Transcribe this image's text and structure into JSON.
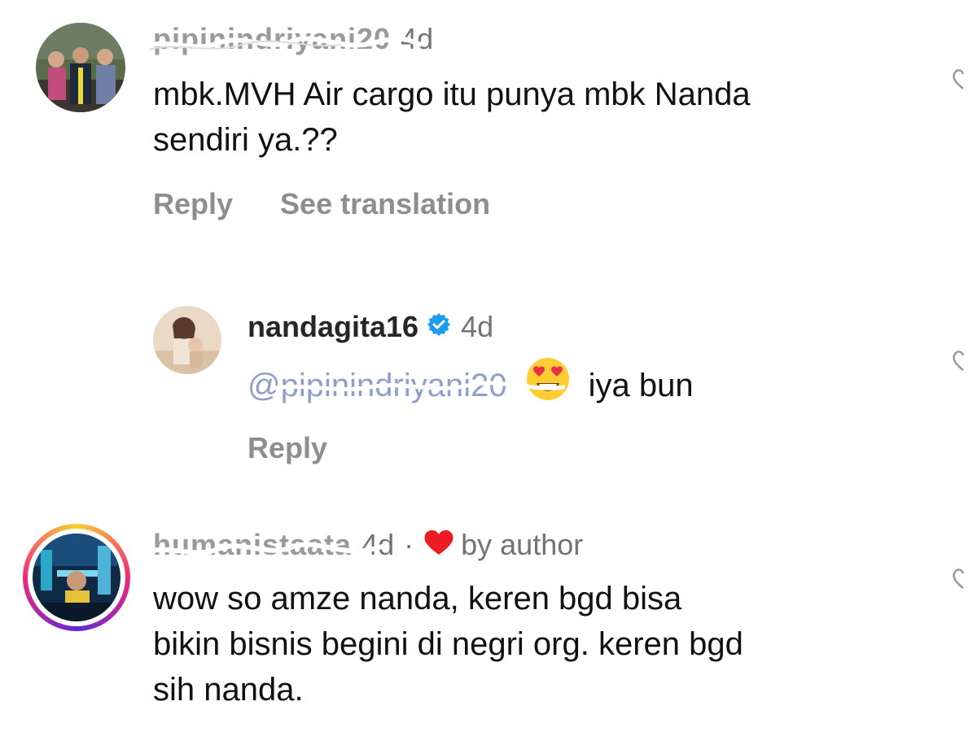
{
  "colors": {
    "background": "#ffffff",
    "text": "#111111",
    "muted": "#737373",
    "action": "#8e8e8e",
    "mention": "#8fa0c8",
    "verified": "#1d9bf0",
    "heart": "#ed1c24"
  },
  "comments": [
    {
      "username": "pipinindriyani20",
      "timestamp": "4d",
      "text_lines": [
        "mbk.MVH Air cargo itu punya mbk Nanda",
        "sendiri ya.??"
      ],
      "actions": {
        "reply": "Reply",
        "translate": "See translation"
      },
      "like_icon": "heart-outline-icon"
    },
    {
      "username": "nandagita16",
      "verified_icon": "verified-badge-icon",
      "timestamp": "4d",
      "mention": "@pipinindriyani20",
      "emoji": "heart-eyes-emoji",
      "text": "iya bun",
      "actions": {
        "reply": "Reply"
      },
      "like_icon": "heart-outline-icon"
    },
    {
      "username": "humanistaata",
      "timestamp": "4d",
      "separator": "·",
      "liked_by": "by author",
      "liked_icon": "red-heart-icon",
      "text_lines": [
        "wow so amze nanda, keren bgd bisa",
        "bikin bisnis begini di negri org. keren bgd",
        "sih nanda."
      ],
      "like_icon": "heart-outline-icon"
    }
  ]
}
